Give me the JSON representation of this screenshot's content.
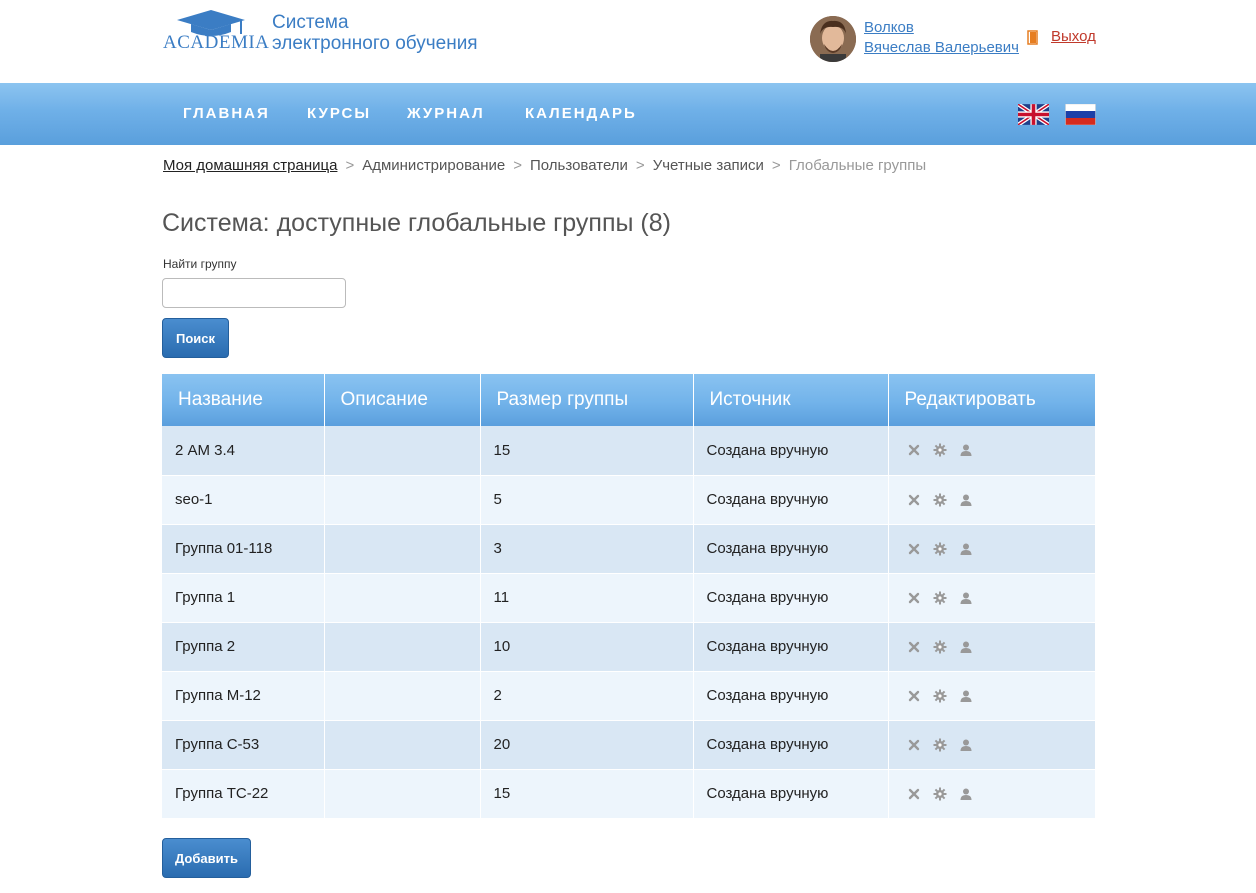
{
  "header": {
    "logo_text": "ACADEMIA",
    "site_title_line1": "Система",
    "site_title_line2": "электронного обучения",
    "user_last_name": "Волков",
    "user_first_names": "Вячеслав Валерьевич",
    "logout_label": "Выход"
  },
  "nav": {
    "items": [
      "ГЛАВНАЯ",
      "КУРСЫ",
      "ЖУРНАЛ",
      "КАЛЕНДАРЬ"
    ],
    "languages": [
      "en",
      "ru"
    ]
  },
  "breadcrumb": {
    "items": [
      "Моя домашняя страница",
      "Администрирование",
      "Пользователи",
      "Учетные записи",
      "Глобальные группы"
    ]
  },
  "page": {
    "title": "Система: доступные глобальные группы (8)",
    "find_label": "Найти группу",
    "find_value": "",
    "search_button": "Поиск",
    "add_button": "Добавить"
  },
  "table": {
    "headers": [
      "Название",
      "Описание",
      "Размер группы",
      "Источник",
      "Редактировать"
    ],
    "rows": [
      {
        "name": "2 АМ 3.4",
        "description": "",
        "size": "15",
        "source": "Создана вручную"
      },
      {
        "name": "seo-1",
        "description": "",
        "size": "5",
        "source": "Создана вручную"
      },
      {
        "name": "Группа 01-118",
        "description": "",
        "size": "3",
        "source": "Создана вручную"
      },
      {
        "name": "Группа 1",
        "description": "",
        "size": "11",
        "source": "Создана вручную"
      },
      {
        "name": "Группа 2",
        "description": "",
        "size": "10",
        "source": "Создана вручную"
      },
      {
        "name": "Группа М-12",
        "description": "",
        "size": "2",
        "source": "Создана вручную"
      },
      {
        "name": "Группа С-53",
        "description": "",
        "size": "20",
        "source": "Создана вручную"
      },
      {
        "name": "Группа ТС-22",
        "description": "",
        "size": "15",
        "source": "Создана вручную"
      }
    ],
    "action_icons": [
      "delete-icon",
      "settings-icon",
      "users-icon"
    ]
  },
  "colors": {
    "brand_blue": "#3b7dc4",
    "nav_blue": "#6fb0e8",
    "row_odd": "#d9e7f4",
    "row_even": "#edf5fc",
    "logout_red": "#c0392b"
  }
}
